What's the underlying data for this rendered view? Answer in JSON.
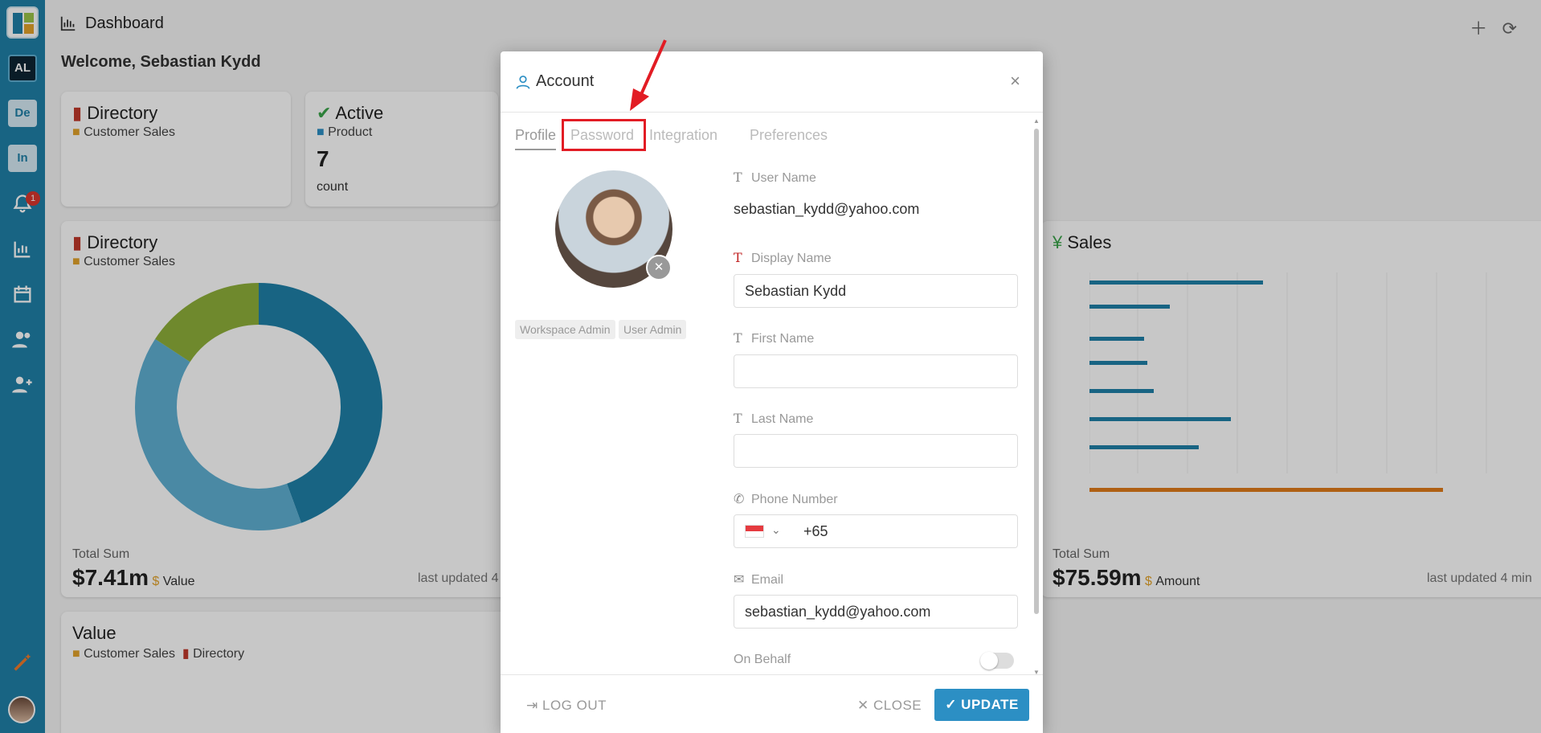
{
  "header": {
    "title": "Dashboard",
    "welcome": "Welcome, Sebastian Kydd"
  },
  "sidebar": {
    "badges": [
      "AL",
      "De",
      "In"
    ],
    "notification_count": "1"
  },
  "cards": {
    "directory_small": {
      "title": "Directory",
      "sub": "Customer Sales"
    },
    "active": {
      "title": "Active",
      "sub": "Product",
      "value": "7",
      "unit": "count"
    },
    "directory_donut": {
      "title": "Directory",
      "sub": "Customer Sales",
      "total_label": "Total Sum",
      "total": "$7.41m",
      "total_unit": "Value",
      "updated": "last updated 4"
    },
    "sales": {
      "title": "Sales",
      "total_label": "Total Sum",
      "total": "$75.59m",
      "total_unit": "Amount",
      "updated": "last updated 4 min"
    },
    "value": {
      "title": "Value",
      "sub1": "Customer Sales",
      "sub2": "Directory"
    }
  },
  "modal": {
    "title": "Account",
    "tabs": [
      "Profile",
      "Password",
      "Integration",
      "Preferences"
    ],
    "roles": [
      "Workspace Admin",
      "User Admin"
    ],
    "fields": {
      "user_name_label": "User Name",
      "user_name": "sebastian_kydd@yahoo.com",
      "display_name_label": "Display Name",
      "display_name": "Sebastian Kydd",
      "first_name_label": "First Name",
      "first_name": "",
      "last_name_label": "Last Name",
      "last_name": "",
      "phone_label": "Phone Number",
      "phone_code": "+65",
      "email_label": "Email",
      "email": "sebastian_kydd@yahoo.com",
      "on_behalf_label": "On Behalf"
    },
    "footer": {
      "logout": "LOG OUT",
      "close": "CLOSE",
      "update": "UPDATE"
    }
  },
  "colors": {
    "sidebar": "#1f80a8",
    "accent": "#2c8fc4",
    "highlight": "#e21c24"
  }
}
